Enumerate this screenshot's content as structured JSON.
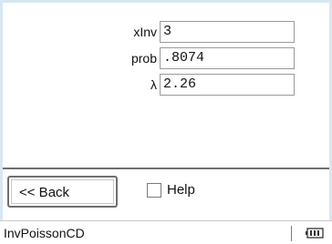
{
  "form": {
    "fields": [
      {
        "label": "xInv",
        "value": "3"
      },
      {
        "label": "prob",
        "value": ".8074"
      },
      {
        "label": "λ",
        "value": "2.26"
      }
    ]
  },
  "buttons": {
    "back_label": "<< Back",
    "help_label": "Help",
    "help_checked": false
  },
  "status_bar": {
    "title": "InvPoissonCD",
    "battery_icon": "battery-icon"
  }
}
